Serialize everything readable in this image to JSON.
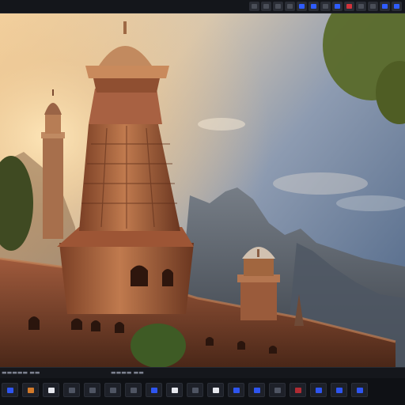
{
  "top_toolbar": {
    "tools": [
      {
        "icon": "grid-icon",
        "tone": "dim"
      },
      {
        "icon": "layers-icon",
        "tone": "dim"
      },
      {
        "icon": "crop-icon",
        "tone": "dim"
      },
      {
        "icon": "brush-icon",
        "tone": "dim"
      },
      {
        "icon": "square-icon",
        "tone": "blue"
      },
      {
        "icon": "select-icon",
        "tone": "blue"
      },
      {
        "icon": "move-icon",
        "tone": "dim"
      },
      {
        "icon": "transform-icon",
        "tone": "blue"
      },
      {
        "icon": "record-icon",
        "tone": "red"
      },
      {
        "icon": "flag-icon",
        "tone": "dim"
      },
      {
        "icon": "settings-icon",
        "tone": "dim"
      },
      {
        "icon": "export-icon",
        "tone": "blue"
      },
      {
        "icon": "share-icon",
        "tone": "blue"
      }
    ]
  },
  "bottom_toolbar": {
    "tools": [
      {
        "icon": "home-icon",
        "tone": "blue"
      },
      {
        "icon": "folder-icon",
        "tone": "orange"
      },
      {
        "icon": "image-icon",
        "tone": "white"
      },
      {
        "icon": "frame-icon",
        "tone": "dim"
      },
      {
        "icon": "timeline-icon",
        "tone": "dim"
      },
      {
        "icon": "camera-icon",
        "tone": "dim"
      },
      {
        "icon": "film-icon",
        "tone": "dim"
      },
      {
        "icon": "monitor-icon",
        "tone": "blue"
      },
      {
        "icon": "crop-icon",
        "tone": "white"
      },
      {
        "icon": "grid-icon",
        "tone": "dim"
      },
      {
        "icon": "circle-icon",
        "tone": "white"
      },
      {
        "icon": "layer-icon",
        "tone": "blue"
      },
      {
        "icon": "adjust-icon",
        "tone": "blue"
      },
      {
        "icon": "fx-icon",
        "tone": "dim"
      },
      {
        "icon": "record-icon",
        "tone": "red"
      },
      {
        "icon": "color-icon",
        "tone": "blue"
      },
      {
        "icon": "audio-icon",
        "tone": "blue"
      },
      {
        "icon": "export-icon",
        "tone": "blue"
      }
    ]
  },
  "colors": {
    "sky_top": "#6f7f96",
    "sun_glow": "#f0c489",
    "temple": "#a8623f",
    "mountain": "#5b626c",
    "ui_dark": "#14161b",
    "accent_blue": "#2f5cff"
  }
}
